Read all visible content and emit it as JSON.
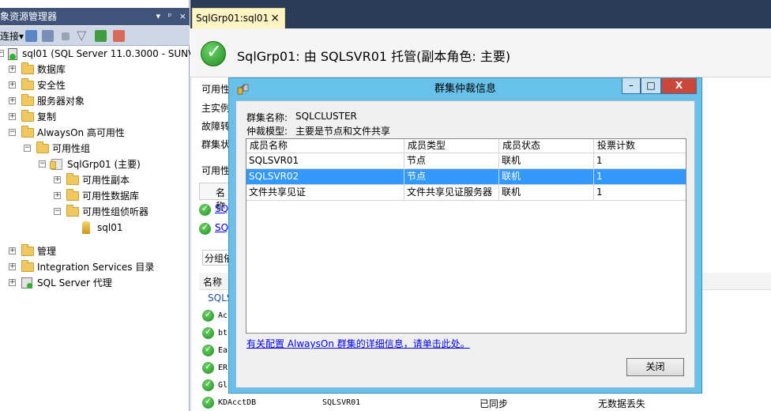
{
  "object_explorer": {
    "title": "象资源管理器",
    "title_buttons": [
      "▾",
      "ᵖ",
      "×"
    ],
    "toolbar_connect": "连接",
    "tree": [
      {
        "label": "sql01 (SQL Server 11.0.3000 - SUNV",
        "icon": "server-icon"
      },
      {
        "label": "数据库",
        "icon": "folder-icon"
      },
      {
        "label": "安全性",
        "icon": "folder-icon"
      },
      {
        "label": "服务器对象",
        "icon": "folder-icon"
      },
      {
        "label": "复制",
        "icon": "folder-icon"
      },
      {
        "label": "AlwaysOn 高可用性",
        "icon": "folder-icon"
      },
      {
        "label": "可用性组",
        "icon": "folder-icon"
      },
      {
        "label": "SqlGrp01 (主要)",
        "icon": "availability-group-icon"
      },
      {
        "label": "可用性副本",
        "icon": "folder-icon"
      },
      {
        "label": "可用性数据库",
        "icon": "folder-icon"
      },
      {
        "label": "可用性组侦听器",
        "icon": "folder-icon"
      },
      {
        "label": "sql01",
        "icon": "listener-icon"
      },
      {
        "label": "管理",
        "icon": "folder-icon"
      },
      {
        "label": "Integration Services 目录",
        "icon": "folder-icon"
      },
      {
        "label": "SQL Server 代理",
        "icon": "agent-icon"
      }
    ]
  },
  "document": {
    "tab_label": "SqlGrp01:sql01",
    "tab_close": "×",
    "header_title": "SqlGrp01: 由 SQLSVR01 托管(副本角色: 主要)",
    "side_labels": [
      "可用性",
      "主实例",
      "故障转",
      "群集状",
      "可用性",
      "分组依"
    ],
    "grid_header_name": "名称",
    "links": [
      "SQ",
      "SQ"
    ],
    "db_section_header": "名称",
    "db_group": "SQLS",
    "databases": [
      {
        "name": "Ac"
      },
      {
        "name": "bt"
      },
      {
        "name": "Ea"
      },
      {
        "name": "ER"
      },
      {
        "name": "Gl"
      },
      {
        "name": "KDAcctDB",
        "replica": "SQLSVR01",
        "state": "已同步",
        "status": "无数据丢失"
      }
    ]
  },
  "dialog": {
    "title": "群集仲裁信息",
    "window_buttons": [
      "–",
      "□",
      "X"
    ],
    "cluster_name_label": "群集名称:",
    "cluster_name_value": "SQLCLUSTER",
    "quorum_model_label": "仲裁模型:",
    "quorum_model_value": "主要是节点和文件共享",
    "columns": [
      "成员名称",
      "成员类型",
      "成员状态",
      "投票计数"
    ],
    "rows": [
      {
        "name": "SQLSVR01",
        "type": "节点",
        "state": "联机",
        "votes": "1",
        "selected": false
      },
      {
        "name": "SQLSVR02",
        "type": "节点",
        "state": "联机",
        "votes": "1",
        "selected": true
      },
      {
        "name": "文件共享见证",
        "type": "文件共享见证服务器",
        "state": "联机",
        "votes": "1",
        "selected": false
      }
    ],
    "help_link": "有关配置 AlwaysOn 群集的详细信息，请单击此处。",
    "close_button": "关闭"
  }
}
